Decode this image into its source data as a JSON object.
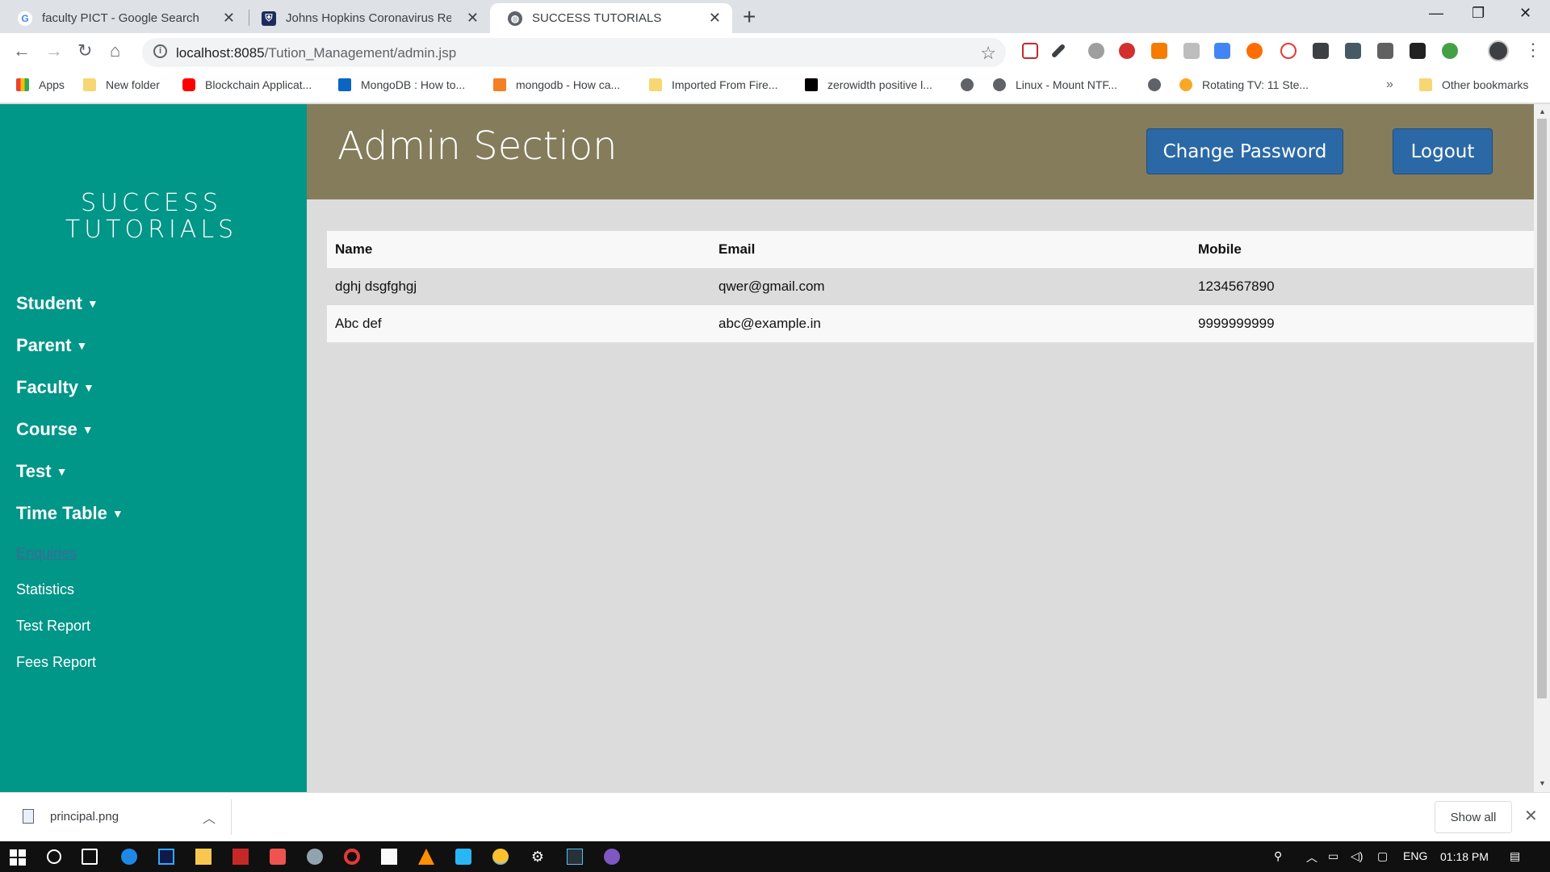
{
  "browser": {
    "tabs": [
      {
        "title": "faculty PICT - Google Search",
        "favicon": "google-icon",
        "active": false
      },
      {
        "title": "Johns Hopkins Coronavirus Reso",
        "favicon": "shield-icon",
        "active": false
      },
      {
        "title": "SUCCESS TUTORIALS",
        "favicon": "globe-icon",
        "active": true
      }
    ],
    "new_tab": "+",
    "window_controls": {
      "minimize": "—",
      "maximize": "❐",
      "close": "✕"
    },
    "nav": {
      "back": "←",
      "forward": "→",
      "reload": "↻",
      "home": "⌂"
    },
    "url_host": "localhost:8085",
    "url_path": "/Tution_Management/admin.jsp",
    "bookmarks": [
      {
        "label": "Apps",
        "icon": "apps-grid-icon"
      },
      {
        "label": "New folder",
        "icon": "folder-icon"
      },
      {
        "label": "Blockchain Applicat...",
        "icon": "youtube-icon"
      },
      {
        "label": "MongoDB : How to...",
        "icon": "linkedin-icon"
      },
      {
        "label": "mongodb - How ca...",
        "icon": "stackoverflow-icon"
      },
      {
        "label": "Imported From Fire...",
        "icon": "folder-icon"
      },
      {
        "label": "zerowidth positive l...",
        "icon": "terminal-icon"
      },
      {
        "label": "",
        "icon": "globe-icon"
      },
      {
        "label": "Linux - Mount NTF...",
        "icon": "globe-icon"
      },
      {
        "label": "",
        "icon": "globe-icon"
      },
      {
        "label": "Rotating TV: 11 Ste...",
        "icon": "instructables-icon"
      }
    ],
    "bookmarks_more": "»",
    "other_bookmarks": "Other bookmarks"
  },
  "sidebar": {
    "brand_line1": "SUCCESS",
    "brand_line2": "TUTORIALS",
    "menus": [
      {
        "label": "Student"
      },
      {
        "label": "Parent"
      },
      {
        "label": "Faculty"
      },
      {
        "label": "Course"
      },
      {
        "label": "Test"
      },
      {
        "label": "Time Table"
      }
    ],
    "links": [
      {
        "label": "Enquiries",
        "visited": true
      },
      {
        "label": "Statistics",
        "visited": false
      },
      {
        "label": "Test Report",
        "visited": false
      },
      {
        "label": "Fees Report",
        "visited": false
      }
    ]
  },
  "header": {
    "title": "Admin Section",
    "change_password": "Change Password",
    "logout": "Logout"
  },
  "table": {
    "columns": [
      "Name",
      "Email",
      "Mobile"
    ],
    "rows": [
      [
        "dghj dsgfghgj",
        "qwer@gmail.com",
        "1234567890"
      ],
      [
        "Abc def",
        "abc@example.in",
        "9999999999"
      ]
    ]
  },
  "downloads": {
    "file": "principal.png",
    "show_all": "Show all",
    "close": "✕"
  },
  "taskbar": {
    "language": "ENG",
    "time": "01:18 PM"
  },
  "colors": {
    "sidebar": "#009688",
    "header": "#857c5c",
    "button": "#2b69a6",
    "page_bg": "#dcdcdc"
  }
}
